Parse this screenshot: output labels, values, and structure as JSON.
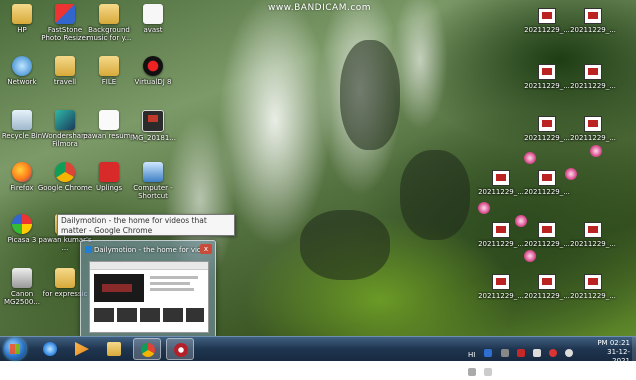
{
  "watermark": "www.BANDICAM.com",
  "desktop_icons": [
    {
      "label": "HP",
      "icon": "hp-folder-icon"
    },
    {
      "label": "FastStone Photo Resizer",
      "icon": "faststone-icon"
    },
    {
      "label": "Background music for y...",
      "icon": "folder-icon"
    },
    {
      "label": "avast",
      "icon": "avast-icon"
    },
    {
      "label": "Network",
      "icon": "network-icon"
    },
    {
      "label": "travell",
      "icon": "folder-icon"
    },
    {
      "label": "FILE",
      "icon": "folder-icon"
    },
    {
      "label": "VirtualDJ 8",
      "icon": "virtualdj-icon"
    },
    {
      "label": "Recycle Bin",
      "icon": "recycle-bin-icon"
    },
    {
      "label": "Wondershare Filmora",
      "icon": "filmora-icon"
    },
    {
      "label": "pawan resume",
      "icon": "document-icon"
    },
    {
      "label": "IMG_20181...",
      "icon": "image-icon"
    },
    {
      "label": "Firefox",
      "icon": "firefox-icon"
    },
    {
      "label": "Google Chrome",
      "icon": "chrome-icon"
    },
    {
      "label": "Uplings",
      "icon": "app-icon"
    },
    {
      "label": "Computer - Shortcut",
      "icon": "computer-icon"
    },
    {
      "label": "Picasa 3",
      "icon": "picasa-icon"
    },
    {
      "label": "pawan kumar's ...",
      "icon": "folder-icon"
    },
    {
      "label": "Canon MG2500...",
      "icon": "printer-icon"
    },
    {
      "label": "for expressic",
      "icon": "folder-icon"
    }
  ],
  "right_files": [
    "20211229_...",
    "20211229_...",
    "20211229_...",
    "20211229_...",
    "20211229_...",
    "20211229_...",
    "20211229_...",
    "20211229_...",
    "20211229_...",
    "20211229_...",
    "20211229_...",
    "20211229_...",
    "20211229_...",
    "20211229_..."
  ],
  "tooltip": "Dailymotion - the home for videos that matter - Google Chrome",
  "preview": {
    "title": "Dailymotion - the home for videos ...",
    "close_label": "x"
  },
  "taskbar": {
    "apps": [
      {
        "name": "internet-explorer",
        "color": "#3a8ee6"
      },
      {
        "name": "media-player",
        "color": "#e58a1f"
      },
      {
        "name": "file-explorer",
        "color": "#e9c45a"
      },
      {
        "name": "google-chrome",
        "color": "#dd4b39"
      },
      {
        "name": "bandicam",
        "color": "#b3202a"
      }
    ],
    "tray_hi": "HI",
    "time": "PM 02:21",
    "date": "31-12-2021"
  }
}
